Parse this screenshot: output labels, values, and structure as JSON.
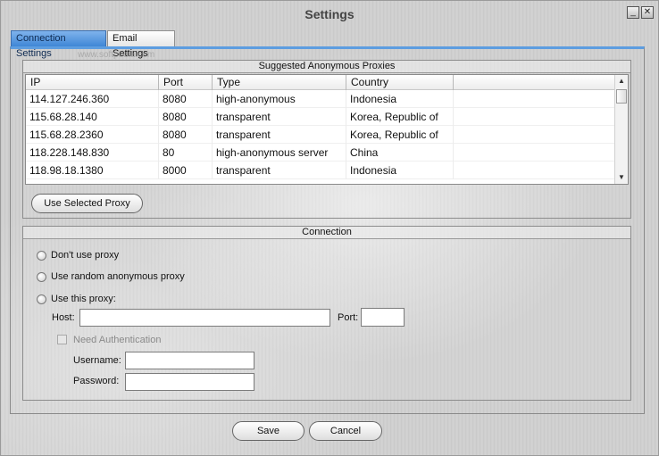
{
  "window": {
    "title": "Settings"
  },
  "tabs": [
    {
      "label": "Connection Settings"
    },
    {
      "label": "Email Settings"
    }
  ],
  "watermark": "www.softpedia.com",
  "proxies": {
    "group_title": "Suggested Anonymous Proxies",
    "columns": [
      "IP",
      "Port",
      "Type",
      "Country"
    ],
    "rows": [
      [
        "114.127.246.360",
        "8080",
        "high-anonymous",
        "Indonesia"
      ],
      [
        "115.68.28.140",
        "8080",
        "transparent",
        "Korea, Republic of"
      ],
      [
        "115.68.28.2360",
        "8080",
        "transparent",
        "Korea, Republic of"
      ],
      [
        "118.228.148.830",
        "80",
        "high-anonymous server",
        "China"
      ],
      [
        "118.98.18.1380",
        "8000",
        "transparent",
        "Indonesia"
      ]
    ],
    "use_selected_label": "Use Selected Proxy"
  },
  "connection": {
    "group_title": "Connection",
    "options": [
      {
        "label": "Don't use proxy"
      },
      {
        "label": "Use random anonymous proxy"
      },
      {
        "label": "Use this proxy:"
      }
    ],
    "host_label": "Host:",
    "host_value": "",
    "port_label": "Port:",
    "port_value": "",
    "need_auth_label": "Need Authentication",
    "username_label": "Username:",
    "username_value": "",
    "password_label": "Password:",
    "password_value": ""
  },
  "buttons": {
    "save": "Save",
    "cancel": "Cancel"
  }
}
